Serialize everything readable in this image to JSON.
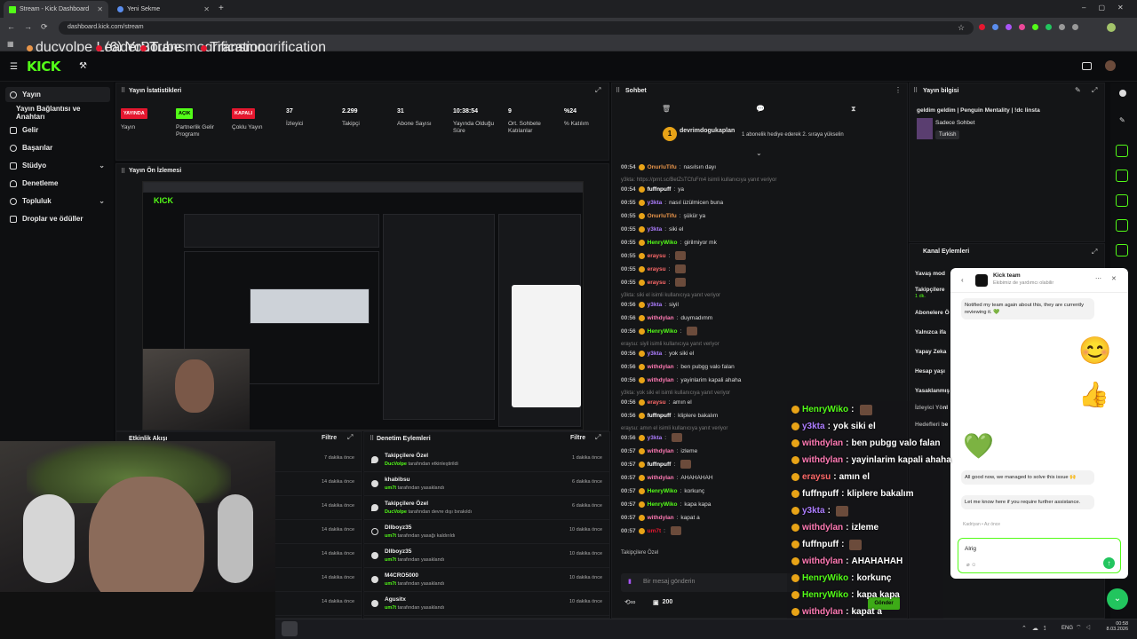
{
  "browser": {
    "tabs": [
      {
        "label": "Stream - Kick Dashboard"
      },
      {
        "label": "Yeni Sekme"
      }
    ],
    "url": "dashboard.kick.com/stream",
    "bookmarks": [
      "ducvolpe LeaderBo...",
      "(6) YouTube",
      "Transmogrification",
      "Transmogrification"
    ]
  },
  "sidebar": {
    "items": [
      {
        "label": "Yayın"
      },
      {
        "label": "Yayın Bağlantısı ve Anahtarı"
      },
      {
        "label": "Gelir"
      },
      {
        "label": "Başarılar"
      },
      {
        "label": "Stüdyo"
      },
      {
        "label": "Denetleme"
      },
      {
        "label": "Topluluk"
      },
      {
        "label": "Droplar ve ödüller"
      }
    ]
  },
  "stats": {
    "title": "Yayın İstatistikleri",
    "items": [
      {
        "value": "YAYINDA",
        "label": "Yayın",
        "color": "#e5172f"
      },
      {
        "value": "AÇIK",
        "label": "Partnerlik Gelir Programı",
        "color": "#53fc18"
      },
      {
        "value": "KAPALI",
        "label": "Çoklu Yayın",
        "color": "#e5172f"
      },
      {
        "value": "37",
        "label": "İzleyici"
      },
      {
        "value": "2.299",
        "label": "Takipçi"
      },
      {
        "value": "31",
        "label": "Abone Sayısı"
      },
      {
        "value": "10:38:54",
        "label": "Yayında Olduğu Süre"
      },
      {
        "value": "9",
        "label": "Ort. Sohbete Katılanlar"
      },
      {
        "value": "%24",
        "label": "% Katılım"
      }
    ]
  },
  "preview": {
    "title": "Yayın Ön İzlemesi"
  },
  "activity": {
    "title": "Etkinlik Akışı",
    "filter": "Filtre",
    "times": [
      "7 dakika önce",
      "14 dakika önce",
      "14 dakika önce",
      "14 dakika önce",
      "14 dakika önce",
      "14 dakika önce",
      "14 dakika önce"
    ]
  },
  "moderation": {
    "title": "Denetim Eylemleri",
    "filter": "Filtre",
    "items": [
      {
        "name": "Takipçilere Özel",
        "by": "DucVolpe",
        "text": "tarafından etkinleştirildi",
        "time": "1 dakika önce"
      },
      {
        "name": "khabibsu",
        "by": "um7t",
        "text": "tarafından yasaklandı",
        "time": "6 dakika önce"
      },
      {
        "name": "Takipçilere Özel",
        "by": "DucVolpe",
        "text": "tarafından devre dışı bırakıldı",
        "time": "6 dakika önce"
      },
      {
        "name": "Dllboyz35",
        "by": "um7t",
        "text": "tarafından yasağı kaldırıldı",
        "time": "10 dakika önce"
      },
      {
        "name": "Dllboyz35",
        "by": "um7t",
        "text": "tarafından yasaklandı",
        "time": "10 dakika önce"
      },
      {
        "name": "M4CRO5000",
        "by": "um7t",
        "text": "tarafından yasaklandı",
        "time": "10 dakika önce"
      },
      {
        "name": "Agusitx",
        "by": "um7t",
        "text": "tarafından yasaklandı",
        "time": "10 dakika önce"
      }
    ]
  },
  "chat": {
    "title": "Sohbet",
    "pinned_user": "devrimdogukaplan",
    "pinned_text": "1 abonelik hediye ederek 2. sıraya yükselin",
    "lines": [
      {
        "ts": "00:54",
        "user": "OnurluTifu",
        "color": "#e8954a",
        "msg": "nasılsın dayı"
      },
      {
        "sys": "y3kta: https://prnt.sc/BetZsTCfuFm4 isimli kullanıcıya yanıt veriyor"
      },
      {
        "ts": "00:54",
        "user": "fuffnpuff",
        "color": "#ffffff",
        "msg": "ya"
      },
      {
        "ts": "00:55",
        "user": "y3kta",
        "color": "#ad7dff",
        "msg": "nasıl üzülmicen buna"
      },
      {
        "ts": "00:55",
        "user": "OnurluTifu",
        "color": "#e8954a",
        "msg": "şükür ya"
      },
      {
        "ts": "00:55",
        "user": "y3kta",
        "color": "#ad7dff",
        "msg": "siki el"
      },
      {
        "ts": "00:55",
        "user": "HenryWiko",
        "color": "#53fc18",
        "msg": "girilmiyor mk"
      },
      {
        "ts": "00:55",
        "user": "eraysu",
        "color": "#ff6a6a",
        "msg": ""
      },
      {
        "ts": "00:55",
        "user": "eraysu",
        "color": "#ff6a6a",
        "msg": ""
      },
      {
        "ts": "00:55",
        "user": "eraysu",
        "color": "#ff6a6a",
        "msg": ""
      },
      {
        "sys": "y3kta: siki el isimli kullanıcıya yanıt veriyor"
      },
      {
        "ts": "00:56",
        "user": "y3kta",
        "color": "#ad7dff",
        "msg": "siyil"
      },
      {
        "ts": "00:56",
        "user": "withdylan",
        "color": "#ff7ab4",
        "msg": "duymadımm"
      },
      {
        "ts": "00:56",
        "user": "HenryWiko",
        "color": "#53fc18",
        "msg": ""
      },
      {
        "sys": "eraysu: siyil isimli kullanıcıya yanıt veriyor"
      },
      {
        "ts": "00:56",
        "user": "y3kta",
        "color": "#ad7dff",
        "msg": "yok siki el"
      },
      {
        "ts": "00:56",
        "user": "withdylan",
        "color": "#ff7ab4",
        "msg": "ben pubgg valo falan"
      },
      {
        "ts": "00:56",
        "user": "withdylan",
        "color": "#ff7ab4",
        "msg": "yayinlarim kapali ahaha"
      },
      {
        "sys": "y3kta: yok siki el isimli kullanıcıya yanıt veriyor"
      },
      {
        "ts": "00:56",
        "user": "eraysu",
        "color": "#ff6a6a",
        "msg": "amın el"
      },
      {
        "ts": "00:56",
        "user": "fuffnpuff",
        "color": "#ffffff",
        "msg": "kliplere bakalım"
      },
      {
        "sys": "eraysu: amın el isimli kullanıcıya yanıt veriyor"
      },
      {
        "ts": "00:56",
        "user": "y3kta",
        "color": "#ad7dff",
        "msg": ""
      },
      {
        "ts": "00:57",
        "user": "withdylan",
        "color": "#ff7ab4",
        "msg": "izleme"
      },
      {
        "ts": "00:57",
        "user": "fuffnpuff",
        "color": "#ffffff",
        "msg": ""
      },
      {
        "ts": "00:57",
        "user": "withdylan",
        "color": "#ff7ab4",
        "msg": "AHAHAHAH"
      },
      {
        "ts": "00:57",
        "user": "HenryWiko",
        "color": "#53fc18",
        "msg": "korkunç"
      },
      {
        "ts": "00:57",
        "user": "HenryWiko",
        "color": "#53fc18",
        "msg": "kapa kapa"
      },
      {
        "ts": "00:57",
        "user": "withdylan",
        "color": "#ff7ab4",
        "msg": "kapat a"
      },
      {
        "ts": "00:57",
        "user": "um7t",
        "color": "#e5172f",
        "msg": ""
      }
    ],
    "followers_only": "Takipçilere Özel",
    "input_placeholder": "Bir mesaj gönderin",
    "points": "200",
    "send_label": "Gönder"
  },
  "overlay": {
    "lines": [
      {
        "user": "HenryWiko",
        "color": "#53fc18",
        "msg": ""
      },
      {
        "user": "y3kta",
        "color": "#ad7dff",
        "msg": "yok siki el"
      },
      {
        "user": "withdylan",
        "color": "#ff7ab4",
        "msg": "ben pubgg valo falan"
      },
      {
        "user": "withdylan",
        "color": "#ff7ab4",
        "msg": "yayinlarim kapali ahaha"
      },
      {
        "user": "eraysu",
        "color": "#ff6a6a",
        "msg": "amın el"
      },
      {
        "user": "fuffnpuff",
        "color": "#ffffff",
        "msg": "kliplere bakalım"
      },
      {
        "user": "y3kta",
        "color": "#ad7dff",
        "msg": ""
      },
      {
        "user": "withdylan",
        "color": "#ff7ab4",
        "msg": "izleme"
      },
      {
        "user": "fuffnpuff",
        "color": "#ffffff",
        "msg": ""
      },
      {
        "user": "withdylan",
        "color": "#ff7ab4",
        "msg": "AHAHAHAH"
      },
      {
        "user": "HenryWiko",
        "color": "#53fc18",
        "msg": "korkunç"
      },
      {
        "user": "HenryWiko",
        "color": "#53fc18",
        "msg": "kapa kapa"
      },
      {
        "user": "withdylan",
        "color": "#ff7ab4",
        "msg": "kapat a"
      },
      {
        "user": "um7t",
        "color": "#e5172f",
        "msg": ""
      }
    ]
  },
  "stream_info": {
    "title": "Yayın bilgisi",
    "stream_title": "geldim geldim | Penguin Mentality | !dc linsta",
    "category": "Sadece Sohbet",
    "tag": "Turkish"
  },
  "channel_actions": {
    "title": "Kanal Eylemleri",
    "items": [
      "Yavaş mod",
      "Takipçilere",
      "1 dk.",
      "Abonelere Ö",
      "Yalnızca ifa",
      "Yapay Zeka",
      "Hesap yaşı",
      "Yasaklanmış",
      "İzleyici Yönl",
      "Hedefleri be"
    ]
  },
  "support": {
    "name": "Kick team",
    "subtitle": "Ekibimiz de yardımcı olabilir",
    "msg1": "Notified my team again about this, they are currently reviewing it. 💚",
    "msg2": "All good now, we managed to solve this issue 🙌",
    "msg3": "Let me know here if you require further assistance.",
    "meta": "Kadriyan • Az önce",
    "input": "Alrig"
  },
  "taskbar": {
    "lang": "ENG",
    "time": "00:58",
    "date": "8.03.2026"
  },
  "colors": {
    "accent": "#53fc18",
    "bg": "#0b0c0e",
    "panel": "#141517",
    "red": "#e5172f"
  }
}
